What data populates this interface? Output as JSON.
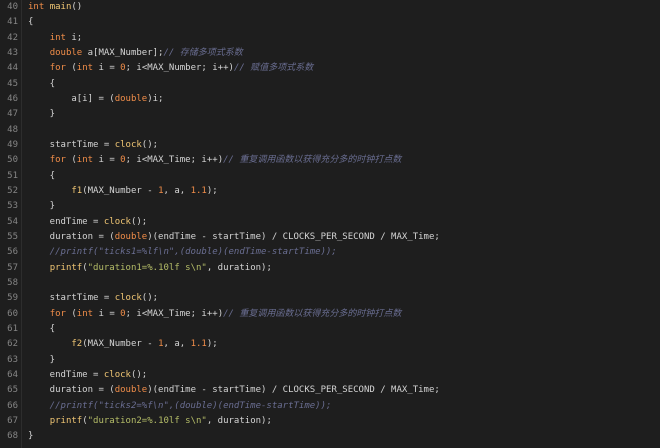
{
  "editor": {
    "lines": [
      {
        "n": "40",
        "tokens": [
          {
            "c": "kw",
            "t": "int"
          },
          {
            "c": "pl",
            "t": " "
          },
          {
            "c": "fn",
            "t": "main"
          },
          {
            "c": "pl",
            "t": "()"
          }
        ]
      },
      {
        "n": "41",
        "tokens": [
          {
            "c": "pl",
            "t": "{"
          }
        ]
      },
      {
        "n": "42",
        "tokens": [
          {
            "c": "pl",
            "t": "    "
          },
          {
            "c": "kw",
            "t": "int"
          },
          {
            "c": "pl",
            "t": " i;"
          }
        ]
      },
      {
        "n": "43",
        "tokens": [
          {
            "c": "pl",
            "t": "    "
          },
          {
            "c": "kw",
            "t": "double"
          },
          {
            "c": "pl",
            "t": " a[MAX_Number];"
          },
          {
            "c": "cm",
            "t": "// 存储多项式系数"
          }
        ]
      },
      {
        "n": "44",
        "tokens": [
          {
            "c": "pl",
            "t": "    "
          },
          {
            "c": "kw",
            "t": "for"
          },
          {
            "c": "pl",
            "t": " ("
          },
          {
            "c": "kw",
            "t": "int"
          },
          {
            "c": "pl",
            "t": " i = "
          },
          {
            "c": "num",
            "t": "0"
          },
          {
            "c": "pl",
            "t": "; i<MAX_Number; i++)"
          },
          {
            "c": "cm",
            "t": "// 赋值多项式系数"
          }
        ]
      },
      {
        "n": "45",
        "tokens": [
          {
            "c": "pl",
            "t": "    {"
          }
        ]
      },
      {
        "n": "46",
        "tokens": [
          {
            "c": "pl",
            "t": "        a[i] = ("
          },
          {
            "c": "kw",
            "t": "double"
          },
          {
            "c": "pl",
            "t": ")i;"
          }
        ]
      },
      {
        "n": "47",
        "tokens": [
          {
            "c": "pl",
            "t": "    }"
          }
        ]
      },
      {
        "n": "48",
        "tokens": []
      },
      {
        "n": "49",
        "tokens": [
          {
            "c": "pl",
            "t": "    startTime = "
          },
          {
            "c": "fn",
            "t": "clock"
          },
          {
            "c": "pl",
            "t": "();"
          }
        ]
      },
      {
        "n": "50",
        "tokens": [
          {
            "c": "pl",
            "t": "    "
          },
          {
            "c": "kw",
            "t": "for"
          },
          {
            "c": "pl",
            "t": " ("
          },
          {
            "c": "kw",
            "t": "int"
          },
          {
            "c": "pl",
            "t": " i = "
          },
          {
            "c": "num",
            "t": "0"
          },
          {
            "c": "pl",
            "t": "; i<MAX_Time; i++)"
          },
          {
            "c": "cm",
            "t": "// 重复调用函数以获得充分多的时钟打点数"
          }
        ]
      },
      {
        "n": "51",
        "tokens": [
          {
            "c": "pl",
            "t": "    {"
          }
        ]
      },
      {
        "n": "52",
        "tokens": [
          {
            "c": "pl",
            "t": "        "
          },
          {
            "c": "fn",
            "t": "f1"
          },
          {
            "c": "pl",
            "t": "(MAX_Number - "
          },
          {
            "c": "num",
            "t": "1"
          },
          {
            "c": "pl",
            "t": ", a, "
          },
          {
            "c": "num",
            "t": "1.1"
          },
          {
            "c": "pl",
            "t": ");"
          }
        ]
      },
      {
        "n": "53",
        "tokens": [
          {
            "c": "pl",
            "t": "    }"
          }
        ]
      },
      {
        "n": "54",
        "tokens": [
          {
            "c": "pl",
            "t": "    endTime = "
          },
          {
            "c": "fn",
            "t": "clock"
          },
          {
            "c": "pl",
            "t": "();"
          }
        ]
      },
      {
        "n": "55",
        "tokens": [
          {
            "c": "pl",
            "t": "    duration = ("
          },
          {
            "c": "kw",
            "t": "double"
          },
          {
            "c": "pl",
            "t": ")(endTime - startTime) / CLOCKS_PER_SECOND / MAX_Time;"
          }
        ]
      },
      {
        "n": "56",
        "tokens": [
          {
            "c": "cm",
            "t": "    //printf(\"ticks1=%lf\\n\",(double)(endTime-startTime));"
          }
        ]
      },
      {
        "n": "57",
        "tokens": [
          {
            "c": "pl",
            "t": "    "
          },
          {
            "c": "fn",
            "t": "printf"
          },
          {
            "c": "pl",
            "t": "("
          },
          {
            "c": "str",
            "t": "\"duration1=%.10lf s\\n\""
          },
          {
            "c": "pl",
            "t": ", duration);"
          }
        ]
      },
      {
        "n": "58",
        "tokens": []
      },
      {
        "n": "59",
        "tokens": [
          {
            "c": "pl",
            "t": "    startTime = "
          },
          {
            "c": "fn",
            "t": "clock"
          },
          {
            "c": "pl",
            "t": "();"
          }
        ]
      },
      {
        "n": "60",
        "tokens": [
          {
            "c": "pl",
            "t": "    "
          },
          {
            "c": "kw",
            "t": "for"
          },
          {
            "c": "pl",
            "t": " ("
          },
          {
            "c": "kw",
            "t": "int"
          },
          {
            "c": "pl",
            "t": " i = "
          },
          {
            "c": "num",
            "t": "0"
          },
          {
            "c": "pl",
            "t": "; i<MAX_Time; i++)"
          },
          {
            "c": "cm",
            "t": "// 重复调用函数以获得充分多的时钟打点数"
          }
        ]
      },
      {
        "n": "61",
        "tokens": [
          {
            "c": "pl",
            "t": "    {"
          }
        ]
      },
      {
        "n": "62",
        "tokens": [
          {
            "c": "pl",
            "t": "        "
          },
          {
            "c": "fn",
            "t": "f2"
          },
          {
            "c": "pl",
            "t": "(MAX_Number - "
          },
          {
            "c": "num",
            "t": "1"
          },
          {
            "c": "pl",
            "t": ", a, "
          },
          {
            "c": "num",
            "t": "1.1"
          },
          {
            "c": "pl",
            "t": ");"
          }
        ]
      },
      {
        "n": "63",
        "tokens": [
          {
            "c": "pl",
            "t": "    }"
          }
        ]
      },
      {
        "n": "64",
        "tokens": [
          {
            "c": "pl",
            "t": "    endTime = "
          },
          {
            "c": "fn",
            "t": "clock"
          },
          {
            "c": "pl",
            "t": "();"
          }
        ]
      },
      {
        "n": "65",
        "tokens": [
          {
            "c": "pl",
            "t": "    duration = ("
          },
          {
            "c": "kw",
            "t": "double"
          },
          {
            "c": "pl",
            "t": ")(endTime - startTime) / CLOCKS_PER_SECOND / MAX_Time;"
          }
        ]
      },
      {
        "n": "66",
        "tokens": [
          {
            "c": "cm",
            "t": "    //printf(\"ticks2=%f\\n\",(double)(endTime-startTime));"
          }
        ]
      },
      {
        "n": "67",
        "tokens": [
          {
            "c": "pl",
            "t": "    "
          },
          {
            "c": "fn",
            "t": "printf"
          },
          {
            "c": "pl",
            "t": "("
          },
          {
            "c": "str",
            "t": "\"duration2=%.10lf s\\n\""
          },
          {
            "c": "pl",
            "t": ", duration);"
          }
        ]
      },
      {
        "n": "68",
        "tokens": [
          {
            "c": "pl",
            "t": "}"
          }
        ]
      }
    ]
  },
  "colors": {
    "background": "#1e1e1e",
    "keyword": "#f08d49",
    "function": "#f0c674",
    "number": "#f08d49",
    "string": "#b5bd68",
    "comment": "#6a6e92",
    "plain": "#d4d4d4",
    "line_number": "#858585"
  }
}
